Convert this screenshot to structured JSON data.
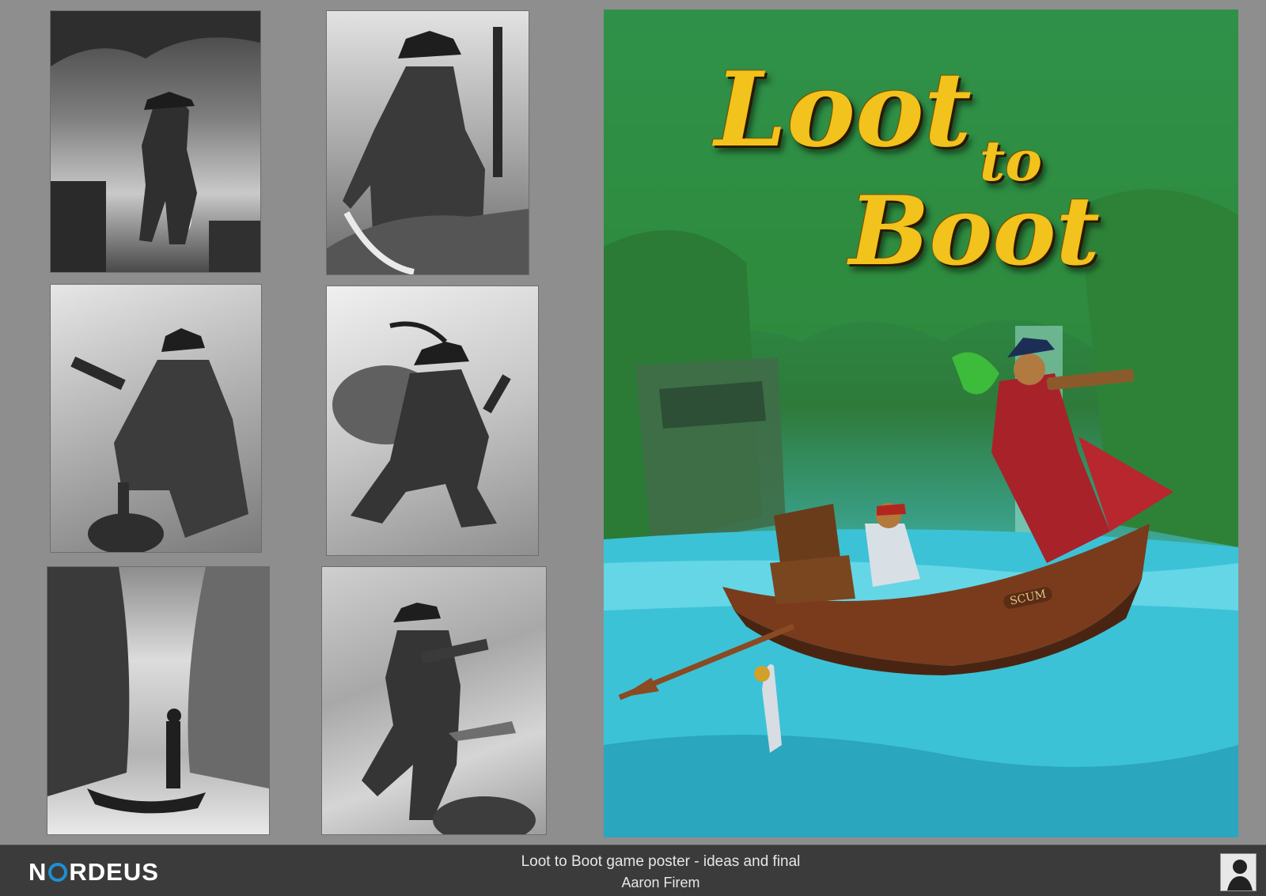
{
  "poster": {
    "title_line1": "Loot",
    "title_line2": "to",
    "title_line3": "Boot",
    "boat_name": "SCUM"
  },
  "footer": {
    "brand_prefix": "N",
    "brand_suffix": "RDEUS",
    "caption_title": "Loot to Boot game poster - ideas and final",
    "caption_author": "Aaron Firem"
  },
  "colors": {
    "footer_bg": "#3b3b3b",
    "brand_accent": "#1f8fd0",
    "title_gold": "#f2c21d",
    "page_bg": "#8e8e8e"
  }
}
